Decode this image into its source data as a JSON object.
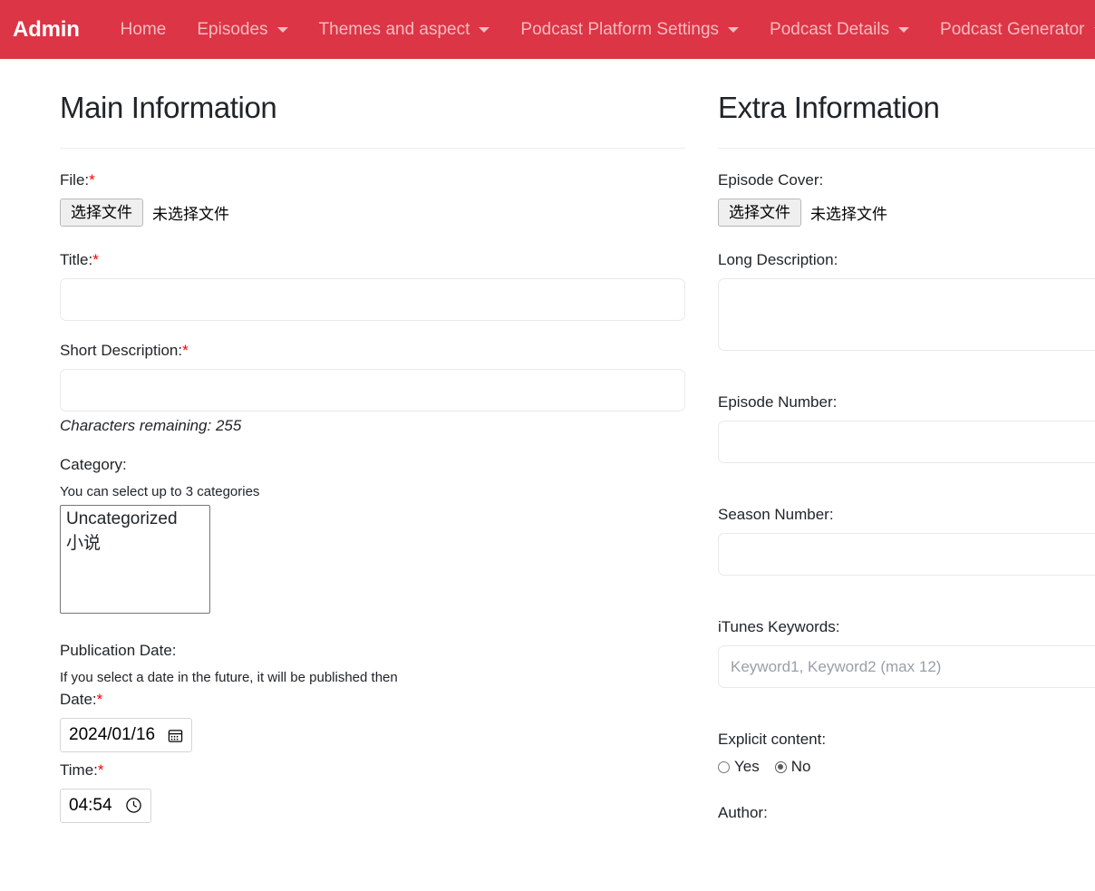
{
  "navbar": {
    "brand": "Admin",
    "items": [
      {
        "label": "Home",
        "has_caret": false
      },
      {
        "label": "Episodes",
        "has_caret": true
      },
      {
        "label": "Themes and aspect",
        "has_caret": true
      },
      {
        "label": "Podcast Platform Settings",
        "has_caret": true
      },
      {
        "label": "Podcast Details",
        "has_caret": true
      },
      {
        "label": "Podcast Generator",
        "has_caret": true
      }
    ],
    "background_color": "#dc3545"
  },
  "main_information": {
    "heading": "Main Information",
    "file": {
      "label": "File:",
      "required_marker": "*",
      "button_label": "选择文件",
      "status_text": "未选择文件"
    },
    "title": {
      "label": "Title:",
      "required_marker": "*",
      "value": "",
      "placeholder": ""
    },
    "short_description": {
      "label": "Short Description:",
      "required_marker": "*",
      "value": "",
      "placeholder": "",
      "characters_remaining": "Characters remaining: 255"
    },
    "category": {
      "label": "Category:",
      "helper": "You can select up to 3 categories",
      "options": [
        "Uncategorized",
        "小说"
      ]
    },
    "publication_date": {
      "label": "Publication Date:",
      "helper": "If you select a date in the future, it will be published then",
      "date": {
        "label": "Date:",
        "required_marker": "*",
        "value": "2024/01/16",
        "icon": "calendar-icon"
      },
      "time": {
        "label": "Time:",
        "required_marker": "*",
        "value": "04:54",
        "icon": "clock-icon"
      }
    }
  },
  "extra_information": {
    "heading": "Extra Information",
    "episode_cover": {
      "label": "Episode Cover:",
      "button_label": "选择文件",
      "status_text": "未选择文件"
    },
    "long_description": {
      "label": "Long Description:",
      "value": "",
      "placeholder": ""
    },
    "episode_number": {
      "label": "Episode Number:",
      "value": "",
      "placeholder": ""
    },
    "season_number": {
      "label": "Season Number:",
      "value": "",
      "placeholder": ""
    },
    "itunes_keywords": {
      "label": "iTunes Keywords:",
      "value": "",
      "placeholder": "Keyword1, Keyword2 (max 12)"
    },
    "explicit_content": {
      "label": "Explicit content:",
      "yes_label": "Yes",
      "no_label": "No",
      "selected": "No"
    },
    "author": {
      "label": "Author:"
    }
  }
}
